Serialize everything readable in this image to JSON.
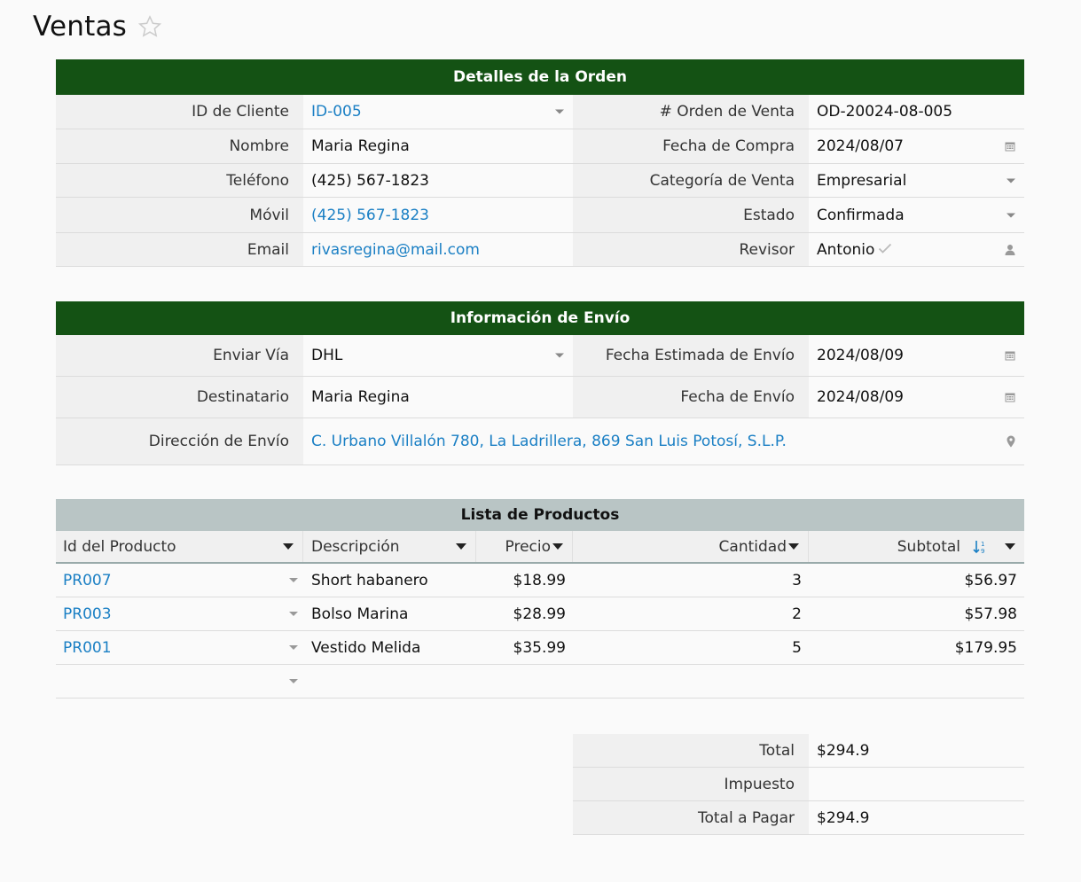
{
  "page": {
    "title": "Ventas"
  },
  "order": {
    "header": "Detalles de la Orden",
    "rows": [
      {
        "l1": "ID de Cliente",
        "v1": "ID-005",
        "l2": "# Orden de Venta",
        "v2": "OD-20024-08-005"
      },
      {
        "l1": "Nombre",
        "v1": "Maria Regina",
        "l2": "Fecha de Compra",
        "v2": "2024/08/07"
      },
      {
        "l1": "Teléfono",
        "v1": "(425) 567-1823",
        "l2": "Categoría de Venta",
        "v2": "Empresarial"
      },
      {
        "l1": "Móvil",
        "v1": "(425) 567-1823",
        "l2": "Estado",
        "v2": "Confirmada"
      },
      {
        "l1": "Email",
        "v1": "rivasregina@mail.com",
        "l2": "Revisor",
        "v2": "Antonio"
      }
    ]
  },
  "shipping": {
    "header": "Información de Envío",
    "via_label": "Enviar Vía",
    "via": "DHL",
    "est_label": "Fecha Estimada de Envío",
    "est": "2024/08/09",
    "recipient_label": "Destinatario",
    "recipient": "Maria Regina",
    "date_label": "Fecha de Envío",
    "date": "2024/08/09",
    "address_label": "Dirección de Envío",
    "address": "C. Urbano Villalón 780, La Ladrillera, 869 San Luis Potosí, S.L.P."
  },
  "products": {
    "header": "Lista de Productos",
    "columns": [
      "Id del Producto",
      "Descripción",
      "Precio",
      "Cantidad",
      "Subtotal"
    ],
    "rows": [
      {
        "id": "PR007",
        "desc": "Short habanero",
        "price": "$18.99",
        "qty": "3",
        "subtotal": "$56.97"
      },
      {
        "id": "PR003",
        "desc": "Bolso Marina",
        "price": "$28.99",
        "qty": "2",
        "subtotal": "$57.98"
      },
      {
        "id": "PR001",
        "desc": "Vestido Melida",
        "price": "$35.99",
        "qty": "5",
        "subtotal": "$179.95"
      }
    ]
  },
  "totals": {
    "total_label": "Total",
    "total": "$294.9",
    "tax_label": "Impuesto",
    "tax": "",
    "pay_label": "Total a Pagar",
    "pay": "$294.9"
  },
  "colors": {
    "header_green": "#145214",
    "link_blue": "#1a7fc4",
    "products_header": "#b9c5c5"
  },
  "icons": [
    "star-icon",
    "dropdown-icon",
    "calendar-icon",
    "checkmark-icon",
    "person-icon",
    "location-pin-icon",
    "sort-icon"
  ]
}
